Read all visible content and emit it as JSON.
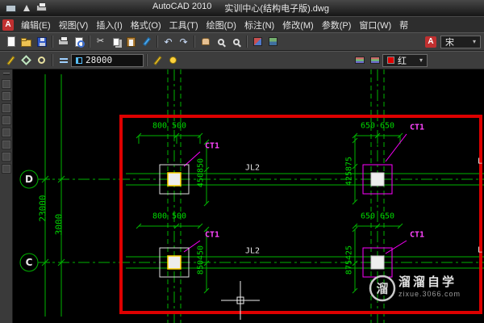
{
  "titlebar": {
    "app": "AutoCAD 2010",
    "doc": "实训中心(结构电子版).dwg"
  },
  "menubar": {
    "items": [
      "编辑(E)",
      "视图(V)",
      "插入(I)",
      "格式(O)",
      "工具(T)",
      "绘图(D)",
      "标注(N)",
      "修改(M)",
      "参数(P)",
      "窗口(W)",
      "帮"
    ]
  },
  "toolbars": {
    "font_name": "宋",
    "value": "28000",
    "color": "红"
  },
  "icons": {
    "dropdown": "▾",
    "undo": "↶",
    "redo": "↷",
    "cut": "✂",
    "text_style": "A"
  },
  "drawing": {
    "axes": [
      "D",
      "C"
    ],
    "dims_h": [
      [
        "800",
        "500"
      ],
      [
        "650",
        "650"
      ],
      [
        "800",
        "500"
      ],
      [
        "650",
        "650"
      ]
    ],
    "dims_v": [
      "450850",
      "425875",
      "850450",
      "875425"
    ],
    "dims_left": [
      "23000",
      "3000"
    ],
    "beam_label": "JL2",
    "column_label": "CT1",
    "cut_label": "L",
    "watermark": {
      "logo_char": "溜",
      "name": "溜溜自学",
      "site": "zixue.3066.com"
    }
  },
  "colors": {
    "selection_red": "#dd0000",
    "cad_green": "#00b400",
    "cad_magenta": "#ff00ff",
    "swatch_red": "#e00000"
  }
}
